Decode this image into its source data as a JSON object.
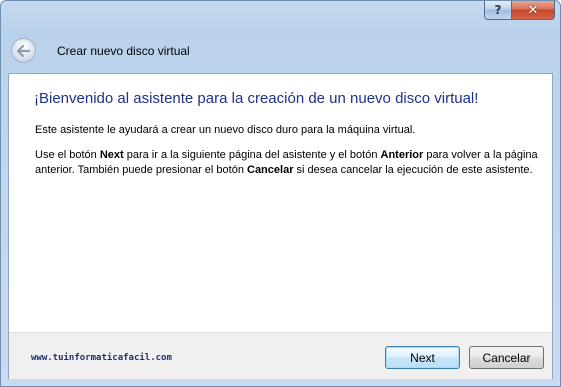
{
  "titlebar": {
    "help_label": "?",
    "close_label": "✕"
  },
  "header": {
    "title": "Crear nuevo disco virtual"
  },
  "content": {
    "heading": "¡Bienvenido al asistente para la creación de un nuevo disco virtual!",
    "paragraph1": "Este asistente le ayudará a crear un nuevo disco duro para la máquina virtual.",
    "paragraph2": {
      "t1": "Use el botón ",
      "b1": "Next",
      "t2": " para ir a la siguiente página del asistente y el botón ",
      "b2": "Anterior",
      "t3": " para volver a la página anterior. También puede presionar el botón ",
      "b3": "Cancelar",
      "t4": " si desea cancelar la ejecución de este asistente."
    }
  },
  "footer": {
    "watermark": "www.tuinformaticafacil.com",
    "next_label": "Next",
    "cancel_label": "Cancelar"
  },
  "icons": {
    "back": "back-arrow-icon",
    "help": "help-icon",
    "close": "close-icon"
  },
  "colors": {
    "heading": "#1e3287",
    "frame": "#bcd3ec",
    "close_button": "#c4472b"
  }
}
